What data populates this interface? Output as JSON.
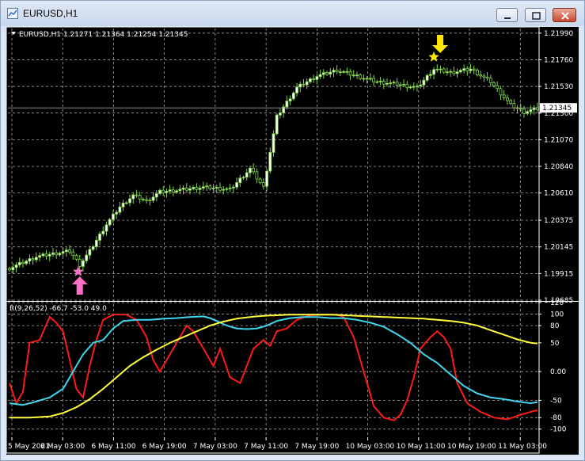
{
  "window": {
    "title": "EURUSD,H1",
    "buttons": [
      "minimize",
      "maximize",
      "close"
    ]
  },
  "main_header": "EURUSD,H1  1.21271 1.21364 1.21254 1.21345",
  "indicator_header": "R(9,26,52) -66.7 -53.0 49.0",
  "price_axis": [
    "1.21990",
    "1.21760",
    "1.21530",
    "1.21300",
    "1.21070",
    "1.20840",
    "1.20610",
    "1.20375",
    "1.20145",
    "1.19915",
    "1.19685"
  ],
  "current_price": "1.21345",
  "indicator_axis": [
    "120",
    "100",
    "80",
    "50",
    "0.00",
    "-50",
    "-80",
    "-100"
  ],
  "time_axis": [
    "5 May 2021",
    "6 May 03:00",
    "6 May 11:00",
    "6 May 19:00",
    "7 May 03:00",
    "7 May 11:00",
    "7 May 19:00",
    "10 May 03:00",
    "10 May 11:00",
    "10 May 19:00",
    "11 May 03:00"
  ],
  "colors": {
    "background": "#000000",
    "grid": "#c0c0c0",
    "bull_candle": "#ffffff",
    "candle_outline": "#7fd34a",
    "bear_candle": "#000000",
    "line_red": "#ff1a1a",
    "line_cyan": "#3fd6f0",
    "line_yellow": "#ffff3a",
    "buy_arrow": "#ff6ec7",
    "sell_arrow": "#ffe600"
  },
  "markers": {
    "buy": {
      "icon": "pink-up-arrow-star",
      "bar_index": 21
    },
    "sell": {
      "icon": "yellow-down-arrow-star",
      "bar_index": 127
    }
  },
  "chart_data": {
    "type": "candlestick",
    "symbol": "EURUSD",
    "timeframe": "H1",
    "ohlc_last": {
      "open": 1.21271,
      "high": 1.21364,
      "low": 1.21254,
      "close": 1.21345
    },
    "price_range": [
      1.19685,
      1.2203
    ],
    "close_anchors": [
      [
        0,
        1.1996
      ],
      [
        8,
        1.2006
      ],
      [
        14,
        1.2009
      ],
      [
        18,
        1.2011
      ],
      [
        21,
        1.1999
      ],
      [
        24,
        1.2011
      ],
      [
        29,
        1.2034
      ],
      [
        33,
        1.2049
      ],
      [
        37,
        1.2059
      ],
      [
        41,
        1.2054
      ],
      [
        45,
        1.2062
      ],
      [
        52,
        1.2064
      ],
      [
        58,
        1.2066
      ],
      [
        66,
        1.2064
      ],
      [
        72,
        1.2082
      ],
      [
        76,
        1.2066
      ],
      [
        80,
        1.2127
      ],
      [
        86,
        1.2152
      ],
      [
        92,
        1.2162
      ],
      [
        98,
        1.2167
      ],
      [
        104,
        1.2162
      ],
      [
        110,
        1.2157
      ],
      [
        116,
        1.2155
      ],
      [
        122,
        1.2152
      ],
      [
        127,
        1.2168
      ],
      [
        132,
        1.2165
      ],
      [
        138,
        1.2168
      ],
      [
        144,
        1.2157
      ],
      [
        150,
        1.2137
      ],
      [
        154,
        1.2131
      ],
      [
        158,
        1.2134
      ]
    ],
    "indicator": {
      "name": "R(9,26,52)",
      "values": [
        -66.7,
        -53.0,
        49.0
      ],
      "range": [
        -110,
        120
      ],
      "series": [
        {
          "color": "red",
          "anchors": [
            [
              0,
              -20
            ],
            [
              2,
              -55
            ],
            [
              4,
              -35
            ],
            [
              6,
              50
            ],
            [
              9,
              55
            ],
            [
              12,
              95
            ],
            [
              14,
              85
            ],
            [
              16,
              70
            ],
            [
              18,
              20
            ],
            [
              20,
              -30
            ],
            [
              22,
              -45
            ],
            [
              24,
              10
            ],
            [
              26,
              55
            ],
            [
              28,
              90
            ],
            [
              31,
              99
            ],
            [
              35,
              99
            ],
            [
              38,
              90
            ],
            [
              41,
              60
            ],
            [
              43,
              20
            ],
            [
              45,
              0
            ],
            [
              47,
              20
            ],
            [
              49,
              40
            ],
            [
              51,
              60
            ],
            [
              53,
              80
            ],
            [
              55,
              70
            ],
            [
              57,
              50
            ],
            [
              59,
              30
            ],
            [
              61,
              10
            ],
            [
              63,
              40
            ],
            [
              66,
              -10
            ],
            [
              69,
              -20
            ],
            [
              71,
              10
            ],
            [
              73,
              40
            ],
            [
              76,
              55
            ],
            [
              78,
              45
            ],
            [
              80,
              70
            ],
            [
              83,
              75
            ],
            [
              86,
              90
            ],
            [
              90,
              98
            ],
            [
              94,
              99
            ],
            [
              98,
              99
            ],
            [
              100,
              95
            ],
            [
              103,
              60
            ],
            [
              106,
              0
            ],
            [
              109,
              -60
            ],
            [
              112,
              -80
            ],
            [
              115,
              -85
            ],
            [
              117,
              -75
            ],
            [
              119,
              -50
            ],
            [
              121,
              -10
            ],
            [
              123,
              40
            ],
            [
              126,
              60
            ],
            [
              128,
              70
            ],
            [
              130,
              60
            ],
            [
              132,
              40
            ],
            [
              134,
              -20
            ],
            [
              137,
              -55
            ],
            [
              141,
              -70
            ],
            [
              145,
              -80
            ],
            [
              149,
              -83
            ],
            [
              153,
              -75
            ],
            [
              156,
              -70
            ],
            [
              158,
              -67
            ]
          ]
        },
        {
          "color": "cyan",
          "anchors": [
            [
              0,
              -55
            ],
            [
              4,
              -58
            ],
            [
              8,
              -52
            ],
            [
              12,
              -45
            ],
            [
              16,
              -30
            ],
            [
              19,
              0
            ],
            [
              22,
              30
            ],
            [
              25,
              50
            ],
            [
              28,
              55
            ],
            [
              31,
              75
            ],
            [
              34,
              88
            ],
            [
              38,
              90
            ],
            [
              42,
              90
            ],
            [
              46,
              92
            ],
            [
              50,
              93
            ],
            [
              54,
              95
            ],
            [
              58,
              96
            ],
            [
              60,
              93
            ],
            [
              62,
              88
            ],
            [
              65,
              80
            ],
            [
              68,
              75
            ],
            [
              71,
              74
            ],
            [
              74,
              75
            ],
            [
              77,
              80
            ],
            [
              80,
              88
            ],
            [
              84,
              93
            ],
            [
              88,
              95
            ],
            [
              92,
              95
            ],
            [
              96,
              93
            ],
            [
              100,
              93
            ],
            [
              104,
              90
            ],
            [
              108,
              85
            ],
            [
              112,
              78
            ],
            [
              116,
              65
            ],
            [
              120,
              50
            ],
            [
              124,
              30
            ],
            [
              128,
              15
            ],
            [
              132,
              -5
            ],
            [
              136,
              -25
            ],
            [
              140,
              -38
            ],
            [
              144,
              -45
            ],
            [
              148,
              -48
            ],
            [
              152,
              -52
            ],
            [
              156,
              -55
            ],
            [
              158,
              -53
            ]
          ]
        },
        {
          "color": "yellow",
          "anchors": [
            [
              0,
              -80
            ],
            [
              6,
              -80
            ],
            [
              12,
              -78
            ],
            [
              16,
              -72
            ],
            [
              20,
              -62
            ],
            [
              24,
              -48
            ],
            [
              28,
              -30
            ],
            [
              32,
              -10
            ],
            [
              36,
              10
            ],
            [
              40,
              25
            ],
            [
              44,
              38
            ],
            [
              48,
              50
            ],
            [
              52,
              60
            ],
            [
              56,
              70
            ],
            [
              60,
              80
            ],
            [
              64,
              87
            ],
            [
              68,
              92
            ],
            [
              72,
              95
            ],
            [
              76,
              97
            ],
            [
              80,
              98
            ],
            [
              84,
              99
            ],
            [
              88,
              99
            ],
            [
              92,
              99
            ],
            [
              96,
              99
            ],
            [
              100,
              98
            ],
            [
              104,
              97
            ],
            [
              108,
              96
            ],
            [
              112,
              95
            ],
            [
              116,
              94
            ],
            [
              120,
              93
            ],
            [
              124,
              92
            ],
            [
              128,
              90
            ],
            [
              132,
              88
            ],
            [
              136,
              85
            ],
            [
              140,
              80
            ],
            [
              144,
              72
            ],
            [
              148,
              64
            ],
            [
              152,
              56
            ],
            [
              156,
              50
            ],
            [
              158,
              49
            ]
          ]
        }
      ]
    }
  }
}
